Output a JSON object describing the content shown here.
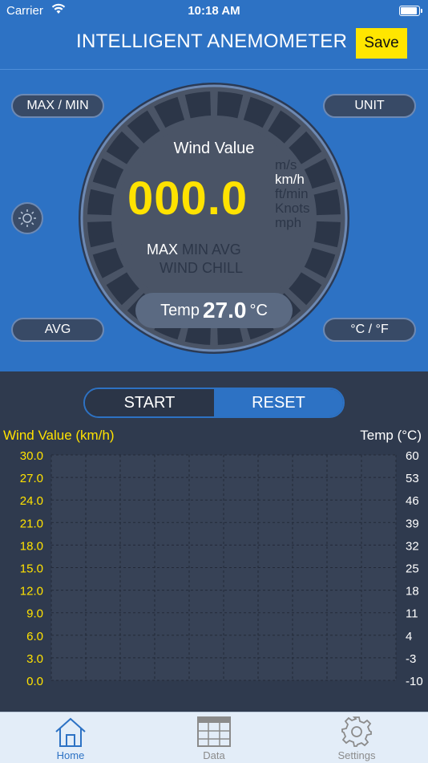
{
  "status": {
    "carrier": "Carrier",
    "time": "10:18 AM"
  },
  "header": {
    "title": "INTELLIGENT ANEMOMETER",
    "save_label": "Save"
  },
  "controls": {
    "max_min": "MAX / MIN",
    "unit": "UNIT",
    "avg": "AVG",
    "temp_toggle": "°C / °F"
  },
  "dial": {
    "title": "Wind Value",
    "value": "000.0",
    "units": [
      "m/s",
      "km/h",
      "ft/min",
      "Knots",
      "mph"
    ],
    "selected_unit": "km/h",
    "modes_row1": [
      "MAX",
      "MIN",
      "AVG"
    ],
    "modes_row2": "WIND CHILL",
    "selected_mode": "MAX",
    "temp_label": "Temp",
    "temp_value": "27.0",
    "temp_unit": "°C"
  },
  "segmented": {
    "start": "START",
    "reset": "RESET",
    "selected": "RESET"
  },
  "chart_data": {
    "type": "line",
    "ylabel_left": "Wind Value (km/h)",
    "ylabel_right": "Temp (°C)",
    "y_left_ticks": [
      "30.0",
      "27.0",
      "24.0",
      "21.0",
      "18.0",
      "15.0",
      "12.0",
      "9.0",
      "6.0",
      "3.0",
      "0.0"
    ],
    "y_right_ticks": [
      "60",
      "53",
      "46",
      "39",
      "32",
      "25",
      "18",
      "11",
      "4",
      "-3",
      "-10"
    ],
    "ylim_left": [
      0,
      30
    ],
    "ylim_right": [
      -10,
      60
    ],
    "series": [],
    "grid": true
  },
  "tabs": [
    {
      "label": "Home",
      "icon": "home-icon",
      "active": true
    },
    {
      "label": "Data",
      "icon": "table-icon",
      "active": false
    },
    {
      "label": "Settings",
      "icon": "gear-icon",
      "active": false
    }
  ],
  "colors": {
    "accent": "#2d72c4",
    "highlight": "#ffe200",
    "background": "#2f3a4e"
  }
}
